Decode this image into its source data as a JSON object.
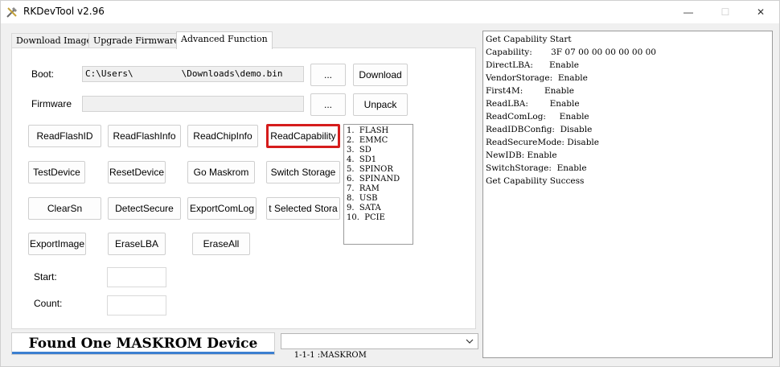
{
  "window": {
    "title": "RKDevTool v2.96",
    "min_glyph": "—",
    "max_glyph": "☐",
    "close_glyph": "✕"
  },
  "tabs": [
    {
      "label": "Download Image",
      "active": false
    },
    {
      "label": "Upgrade Firmware",
      "active": false
    },
    {
      "label": "Advanced Function",
      "active": true
    }
  ],
  "boot": {
    "label": "Boot:",
    "path_prefix": "C:\\Users\\",
    "path_suffix": "\\Downloads\\demo.bin",
    "browse_label": "...",
    "download_label": "Download"
  },
  "firmware": {
    "label": "Firmware",
    "value": "",
    "browse_label": "...",
    "unpack_label": "Unpack"
  },
  "buttons": {
    "read_flash_id": "ReadFlashID",
    "read_flash_info": "ReadFlashInfo",
    "read_chip_info": "ReadChipInfo",
    "read_capability": "ReadCapability",
    "test_device": "TestDevice",
    "reset_device": "ResetDevice",
    "go_maskrom": "Go Maskrom",
    "switch_storage": "Switch Storage",
    "clear_sn": "ClearSn",
    "detect_secure": "DetectSecure",
    "export_com_log": "ExportComLog",
    "export_selected_storage": "t Selected Stora",
    "export_image": "ExportImage",
    "erase_lba": "EraseLBA",
    "erase_all": "EraseAll"
  },
  "storage_list": [
    "1.  FLASH",
    "2.  EMMC",
    "3.  SD",
    "4.  SD1",
    "5.  SPINOR",
    "6.  SPINAND",
    "7.  RAM",
    "8.  USB",
    "9.  SATA",
    "10.  PCIE"
  ],
  "start": {
    "label": "Start:",
    "value": ""
  },
  "count": {
    "label": "Count:",
    "value": ""
  },
  "status_text": "Found One MASKROM Device",
  "device_select": {
    "selected": "1-1-1 :MASKROM"
  },
  "log_lines": [
    "Get Capability Start",
    "Capability:       3F 07 00 00 00 00 00 00",
    "DirectLBA:      Enable",
    "VendorStorage:  Enable",
    "First4M:        Enable",
    "ReadLBA:        Enable",
    "ReadComLog:     Enable",
    "ReadIDBConfig:  Disable",
    "ReadSecureMode: Disable",
    "NewIDB: Enable",
    "SwitchStorage:  Enable",
    "Get Capability Success"
  ],
  "colors": {
    "highlight_border": "#d51c1c",
    "status_accent": "#3b7fd0"
  }
}
